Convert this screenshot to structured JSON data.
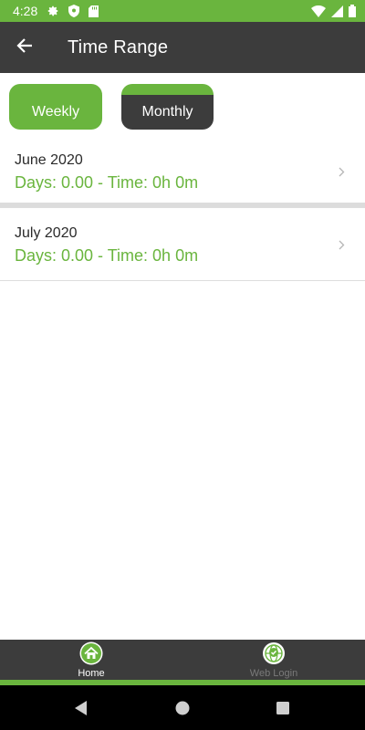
{
  "status_bar": {
    "time": "4:28",
    "icons": [
      "settings-icon",
      "shield-icon",
      "sd-card-icon",
      "wifi-icon",
      "signal-icon",
      "battery-icon"
    ]
  },
  "app_bar": {
    "title": "Time Range",
    "back_icon": "arrow-left-icon"
  },
  "tabs": [
    {
      "label": "Weekly",
      "selected": false
    },
    {
      "label": "Monthly",
      "selected": true
    }
  ],
  "list": [
    {
      "title": "June 2020",
      "subtitle": "Days: 0.00 - Time: 0h 0m"
    },
    {
      "title": "July 2020",
      "subtitle": "Days: 0.00 - Time: 0h 0m"
    }
  ],
  "bottom_nav": [
    {
      "label": "Home",
      "icon": "home-icon",
      "active": true
    },
    {
      "label": "Web Login",
      "icon": "globe-check-icon",
      "active": false
    }
  ],
  "colors": {
    "accent": "#6ab53e",
    "dark": "#3c3c3c"
  }
}
